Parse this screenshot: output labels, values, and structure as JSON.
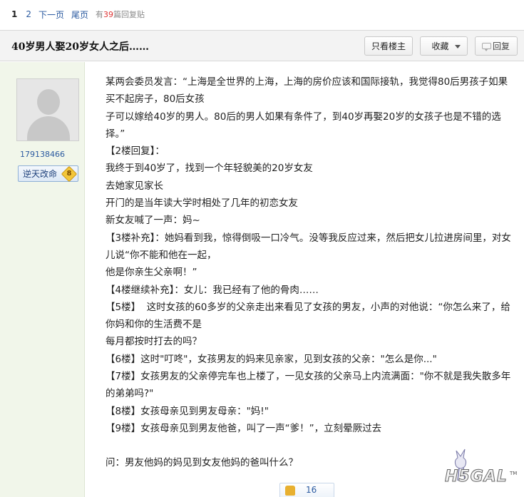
{
  "pagination": {
    "current": "1",
    "page2": "2",
    "next": "下一页",
    "last": "尾页",
    "note_prefix": "有",
    "reply_count": "39",
    "note_suffix": "篇回复贴"
  },
  "thread": {
    "title": "40岁男人娶20岁女人之后……",
    "only_op_label": "只看楼主",
    "favorite_label": "收藏",
    "reply_label": "回复"
  },
  "author": {
    "username": "179138466",
    "rank": "逆天改命",
    "level": "8"
  },
  "post": {
    "lines": [
      "某两会委员发言：“上海是全世界的上海，上海的房价应该和国际接轨，我觉得80后男孩子如果",
      "买不起房子，80后女孩",
      "子可以嫁给40岁的男人。80后的男人如果有条件了，到40岁再娶20岁的女孩子也是不错的选",
      "择。”",
      "【2楼回复】：",
      "我终于到40岁了，找到一个年轻貌美的20岁女友",
      "去她家见家长",
      "开门的是当年读大学时相处了几年的初恋女友",
      "新女友喊了一声：妈~",
      "【3楼补充】：她妈看到我，惊得倒吸一口冷气。没等我反应过来，然后把女儿拉进房间里，对女",
      "儿说“你不能和他在一起，",
      "他是你亲生父亲啊！”",
      "【4楼继续补充】：女儿：我已经有了他的骨肉……",
      "【5楼】  这时女孩的60多岁的父亲走出来看见了女孩的男友，小声的对他说：“你怎么来了，给",
      "你妈和你的生活费不是",
      "每月都按时打去的吗？",
      "【6楼】这时\"叮咚\"，女孩男友的妈来见亲家，见到女孩的父亲：\"怎么是你...\"",
      "【7楼】女孩男友的父亲停完车也上楼了，一见女孩的父亲马上内流满面：\"你不就是我失散多年",
      "的弟弟吗?\"",
      "【8楼】女孩母亲见到男友母亲：\"妈!\"",
      "【9楼】女孩母亲见到男友他爸，叫了一声“爹！”，立刻晕厥过去",
      "",
      "问：男友他妈的妈见到女友他妈的爸叫什么？"
    ]
  },
  "like": {
    "count": "16"
  },
  "watermark": {
    "text": "H5GAL",
    "tm": "TM"
  }
}
